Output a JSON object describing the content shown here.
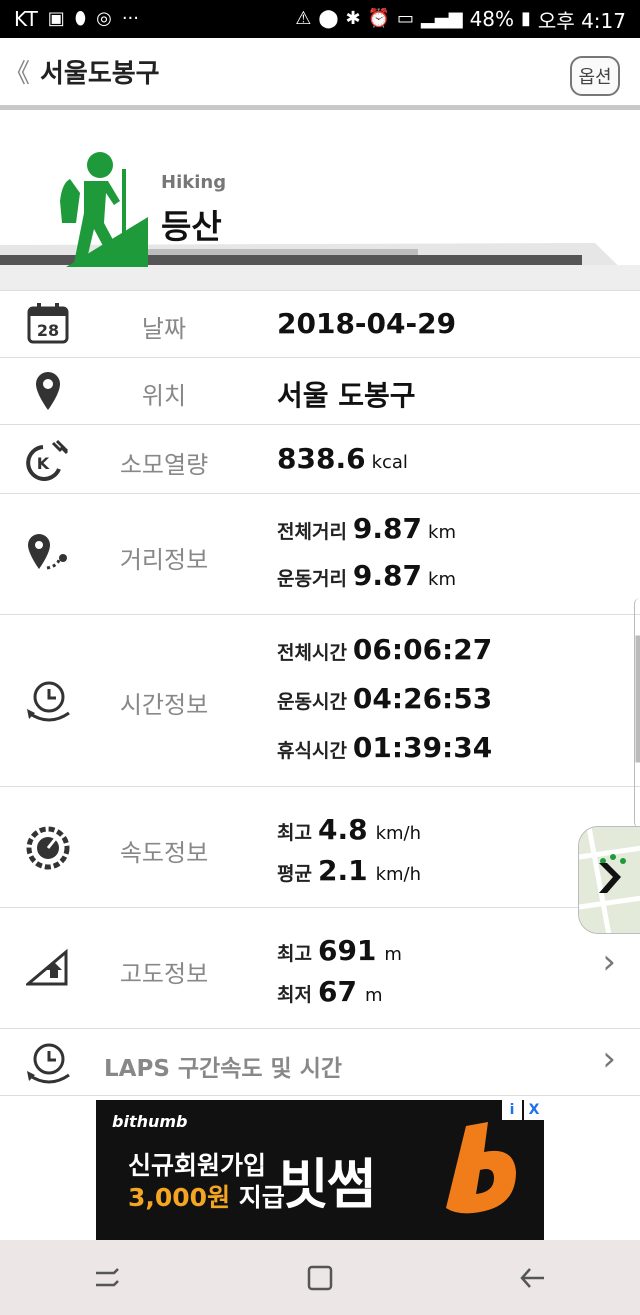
{
  "status": {
    "carrier": "KT",
    "battery": "48%",
    "time": "오후 4:17"
  },
  "header": {
    "back_label": "《",
    "title": "서울도봉구",
    "option_label": "옵션"
  },
  "activity": {
    "en": "Hiking",
    "kr": "등산"
  },
  "rows": {
    "date": {
      "label": "날짜",
      "icon_text": "28",
      "value": "2018-04-29"
    },
    "location": {
      "label": "위치",
      "value": "서울 도봉구"
    },
    "calories": {
      "label": "소모열량",
      "value": "838.6",
      "unit": "kcal"
    },
    "distance": {
      "label": "거리정보",
      "total_label": "전체거리",
      "total_value": "9.87",
      "total_unit": "km",
      "exercise_label": "운동거리",
      "exercise_value": "9.87",
      "exercise_unit": "km"
    },
    "time": {
      "label": "시간정보",
      "total_label": "전체시간",
      "total_value": "06:06:27",
      "exercise_label": "운동시간",
      "exercise_value": "04:26:53",
      "rest_label": "휴식시간",
      "rest_value": "01:39:34"
    },
    "speed": {
      "label": "속도정보",
      "max_label": "최고",
      "max_value": "4.8",
      "max_unit": "km/h",
      "avg_label": "평균",
      "avg_value": "2.1",
      "avg_unit": "km/h"
    },
    "altitude": {
      "label": "고도정보",
      "max_label": "최고",
      "max_value": "691",
      "max_unit": "m",
      "min_label": "최저",
      "min_value": "67",
      "min_unit": "m"
    },
    "laps": {
      "label": "LAPS 구간속도 및 시간"
    }
  },
  "ad": {
    "brand": "bithumb",
    "line1": "신규회원가입",
    "line2_amount": "3,000원",
    "line2_rest": "지급",
    "big": "빗썸",
    "info": "i",
    "close": "X"
  },
  "colors": {
    "hiking_green": "#1f9a3a",
    "ad_orange": "#f4a623"
  }
}
